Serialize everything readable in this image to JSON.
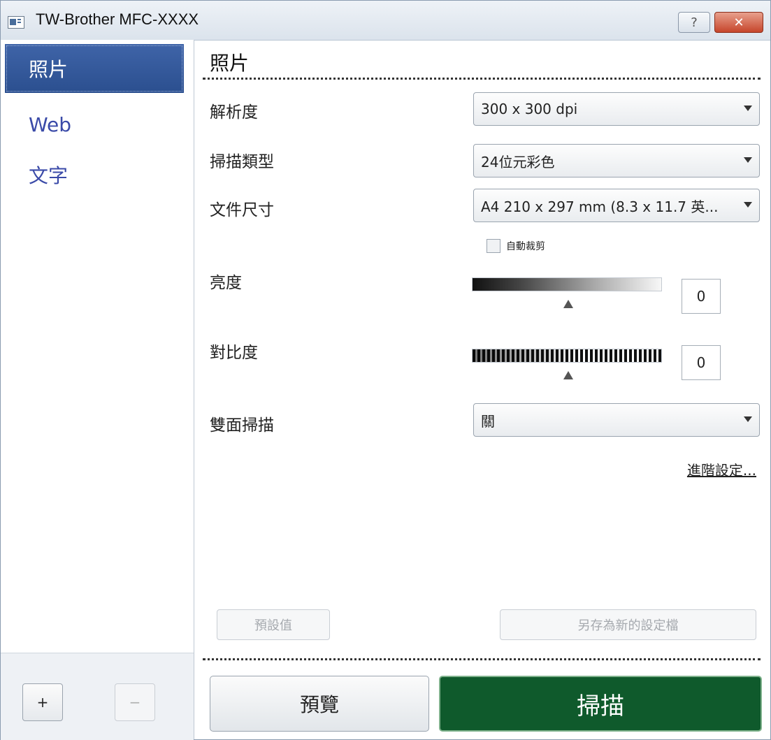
{
  "window": {
    "title": "TW-Brother MFC-XXXX",
    "help_label": "?",
    "close_label": "✕"
  },
  "sidebar": {
    "items": [
      {
        "label": "照片",
        "active": true
      },
      {
        "label": "Web",
        "active": false
      },
      {
        "label": "文字",
        "active": false
      }
    ],
    "add_label": "+",
    "remove_label": "−"
  },
  "main": {
    "section_title": "照片",
    "resolution": {
      "label": "解析度",
      "value": "300 x 300 dpi"
    },
    "scan_type": {
      "label": "掃描類型",
      "value": "24位元彩色"
    },
    "document_size": {
      "label": "文件尺寸",
      "value": "A4 210 x 297 mm (8.3 x 11.7 英..."
    },
    "auto_crop": {
      "label": "自動裁剪",
      "checked": false
    },
    "brightness": {
      "label": "亮度",
      "value": "0"
    },
    "contrast": {
      "label": "對比度",
      "value": "0"
    },
    "duplex": {
      "label": "雙面掃描",
      "value": "關"
    },
    "advanced_link": "進階設定...",
    "default_button": "預設值",
    "save_profile_button": "另存為新的設定檔",
    "preview_button": "預覽",
    "scan_button": "掃描"
  },
  "colors": {
    "scan_button": "#0f5a2c",
    "sidebar_active": "#2b4f8f"
  }
}
